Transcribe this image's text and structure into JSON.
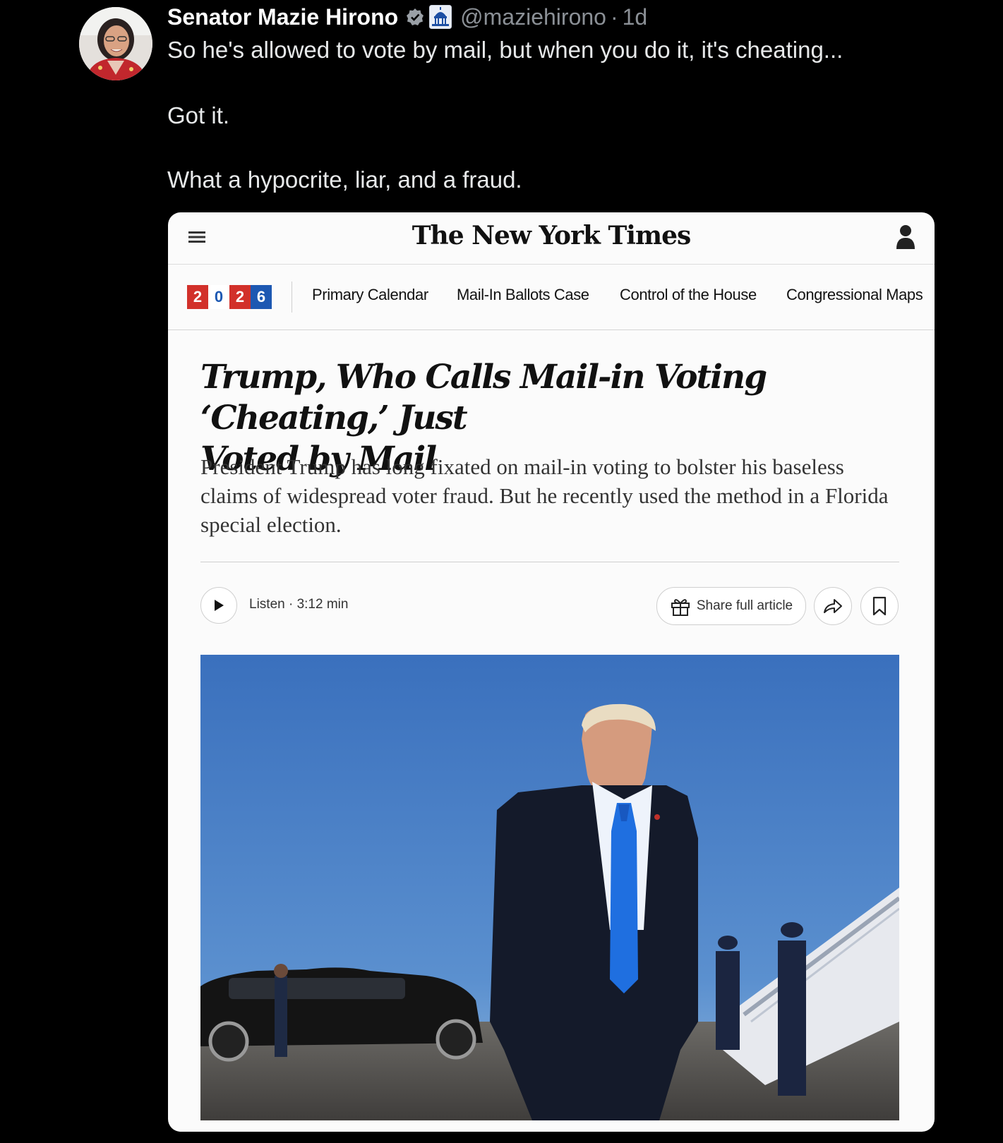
{
  "tweet": {
    "display_name": "Senator Mazie Hirono",
    "handle": "@maziehirono",
    "separator": "·",
    "time": "1d",
    "lines": [
      "So he's allowed to vote by mail, but when you do it, it's cheating...",
      "Got it.",
      "What a hypocrite, liar, and a fraud."
    ],
    "icons": [
      "verified-badge-icon",
      "capitol-affiliation-icon"
    ]
  },
  "article": {
    "logo": "The New York Times",
    "badge_digits": [
      "2",
      "0",
      "2",
      "6"
    ],
    "badge_colors": [
      "#d2302a",
      "#ffffff",
      "#d2302a",
      "#1d58b2"
    ],
    "badge_text_colors": [
      "#ffffff",
      "#1d58b2",
      "#ffffff",
      "#ffffff"
    ],
    "nav": [
      "Primary Calendar",
      "Mail-In Ballots Case",
      "Control of the House",
      "Congressional Maps"
    ],
    "headline_line1": "Trump, Who Calls Mail-in Voting ‘Cheating,’ Just",
    "headline_line2": "Voted by Mail",
    "summary": "President Trump has long fixated on mail-in voting to bolster his baseless claims of widespread voter fraud. But he recently used the method in a Florida special election.",
    "listen": "Listen · 3:12 min",
    "share_label": "Share full article",
    "icons": [
      "menu-icon",
      "user-icon",
      "play-icon",
      "gift-icon",
      "share-arrow-icon",
      "bookmark-icon"
    ]
  },
  "colors": {
    "background": "#000000",
    "card": "#fbfbfb",
    "sky": "#3f78c3",
    "tie": "#1f6fe0"
  }
}
